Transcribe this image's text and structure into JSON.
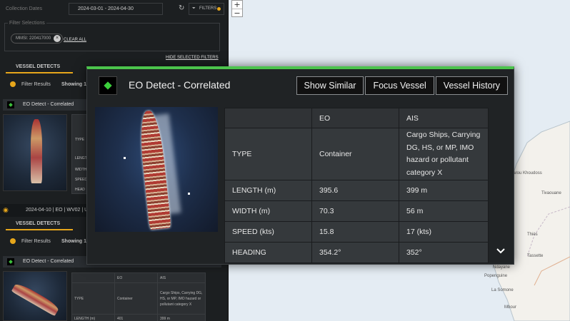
{
  "sidebar": {
    "date_range_label": "Collection Dates",
    "date_range": "2024-03-01  -  2024-04-30",
    "filters_button": "FILTERS",
    "filter_selections_label": "Filter Selections",
    "filter_chip": "MMSI: 220417000",
    "clear_all": "CLEAR ALL",
    "hide_selected_filters": "HIDE SELECTED FILTERS",
    "vessel_detects_tab": "VESSEL DETECTS",
    "filter_results": "Filter Results",
    "showing": "Showing 1",
    "item_title": "EO Detect - Correlated",
    "mini_labels": [
      "TYPE",
      "LENGTH",
      "WIDTH",
      "SPEED",
      "HEAD"
    ],
    "second_record": "2024-04-10 | EO | WV02 | US",
    "vessel_detects_tab_2": "VESSEL DETECTS",
    "filter_results_2": "Filter Results",
    "showing_2": "Showing 1",
    "item_title_2": "EO Detect - Correlated",
    "mini_table": {
      "eo": "EO",
      "ais": "AIS",
      "type": "TYPE",
      "eo_type": "Container",
      "ais_type": "Cargo Ships, Carrying DG, HS, or MP, IMO hazard or pollutant category X",
      "length": "LENGTH (m)",
      "eo_length": "401",
      "ais_length": "399 m"
    }
  },
  "map": {
    "zoom_in": "+",
    "zoom_out": "−",
    "towns": [
      "Darou Khoudoss",
      "Tivaouane",
      "Thiès",
      "Tassette",
      "Ndayane",
      "Popenguine",
      "La Somone",
      "Mbour"
    ]
  },
  "modal": {
    "title": "EO Detect - Correlated",
    "buttons": [
      "Show Similar",
      "Focus Vessel",
      "Vessel History"
    ],
    "table": {
      "headers": [
        "",
        "EO",
        "AIS"
      ],
      "rows": [
        {
          "label": "TYPE",
          "eo": "Container",
          "ais": "Cargo Ships, Carrying DG, HS, or MP, IMO hazard or pollutant category X"
        },
        {
          "label": "LENGTH (m)",
          "eo": "395.6",
          "ais": "399 m"
        },
        {
          "label": "WIDTH (m)",
          "eo": "70.3",
          "ais": "56 m"
        },
        {
          "label": "SPEED (kts)",
          "eo": "15.8",
          "ais": "17 (kts)"
        },
        {
          "label": "HEADING",
          "eo": "354.2°",
          "ais": "352°"
        }
      ]
    }
  },
  "colors": {
    "accent_green": "#4cc44c",
    "accent_orange": "#e6a61b",
    "panel_bg": "#202325",
    "map_water": "#e4ecf3"
  }
}
